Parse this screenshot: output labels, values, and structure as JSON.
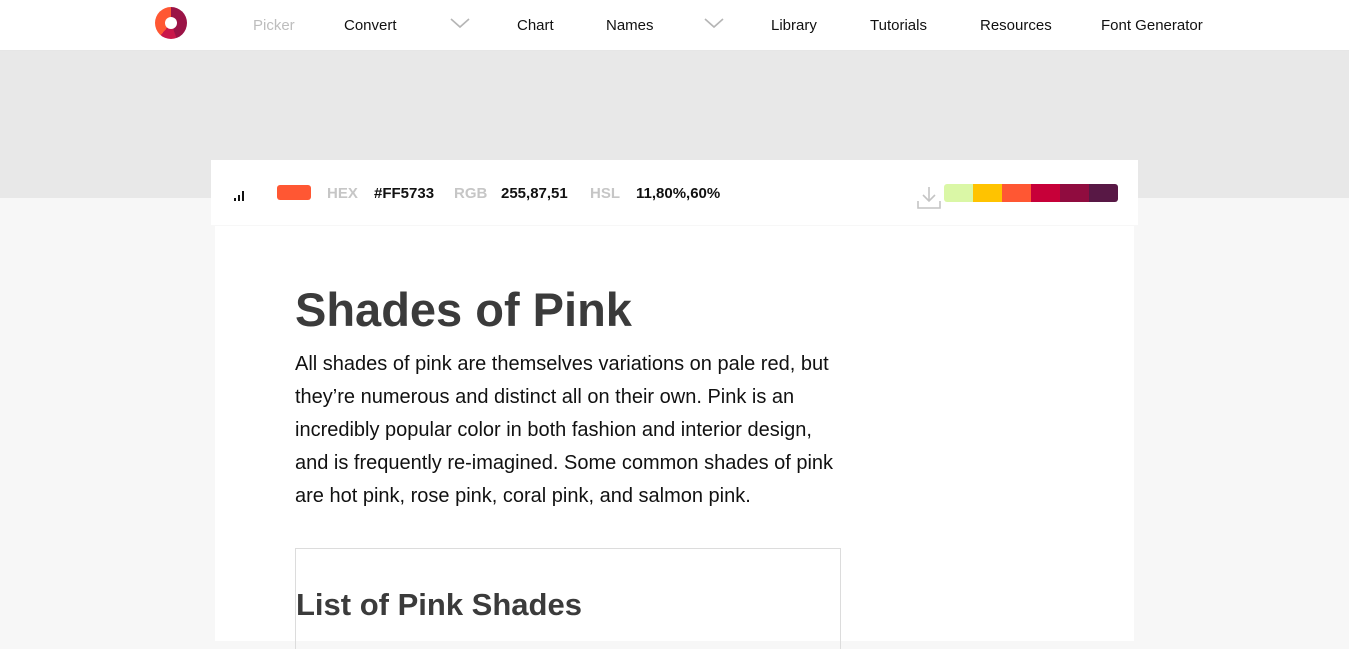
{
  "nav": {
    "items": [
      {
        "label": "Picker"
      },
      {
        "label": "Convert"
      },
      {
        "label": "Chart"
      },
      {
        "label": "Names"
      },
      {
        "label": "Library"
      },
      {
        "label": "Tutorials"
      },
      {
        "label": "Resources"
      },
      {
        "label": "Font Generator"
      }
    ],
    "icons": [
      "logo-icon",
      "chevron-down-icon"
    ]
  },
  "toolbar": {
    "icons": [
      "signal-bars-icon",
      "download-icon"
    ],
    "current_color": "#FF5733",
    "hex_label": "HEX",
    "hex_value": "#FF5733",
    "rgb_label": "RGB",
    "rgb_value": "255,87,51",
    "hsl_label": "HSL",
    "hsl_value": "11,80%,60%",
    "palette": [
      "#DAF7A6",
      "#FFC300",
      "#FF5733",
      "#C70039",
      "#900C3F",
      "#581845"
    ]
  },
  "content": {
    "title": "Shades of Pink",
    "intro": "All shades of pink are themselves variations on pale red, but they’re numerous and distinct all on their own. Pink is an incredibly popular color in both fashion and interior design, and is frequently re-imagined. Some common shades of pink are hot pink, rose pink, coral pink, and salmon pink.",
    "list_title": "List of Pink Shades"
  }
}
